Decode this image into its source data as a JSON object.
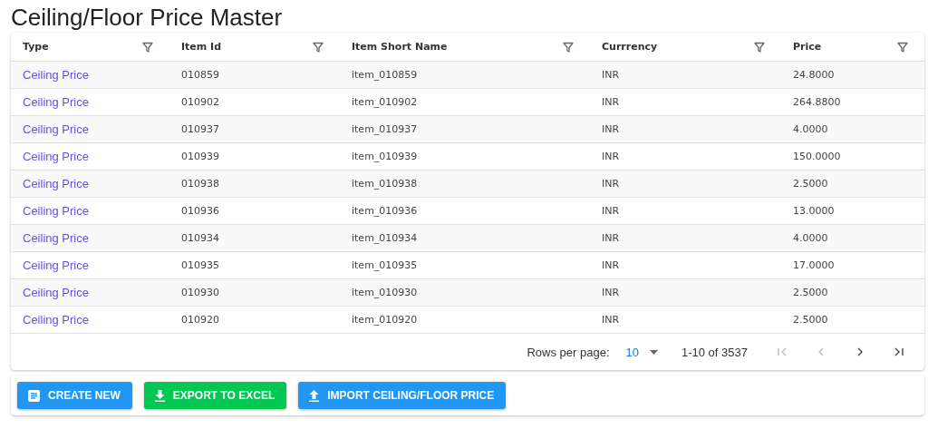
{
  "title": "Ceiling/Floor Price Master",
  "table": {
    "columns": [
      "Type",
      "Item Id",
      "Item Short Name",
      "Currrency",
      "Price"
    ],
    "rows": [
      [
        "Ceiling Price",
        "010859",
        "item_010859",
        "INR",
        "24.8000"
      ],
      [
        "Ceiling Price",
        "010902",
        "item_010902",
        "INR",
        "264.8800"
      ],
      [
        "Ceiling Price",
        "010937",
        "item_010937",
        "INR",
        "4.0000"
      ],
      [
        "Ceiling Price",
        "010939",
        "item_010939",
        "INR",
        "150.0000"
      ],
      [
        "Ceiling Price",
        "010938",
        "item_010938",
        "INR",
        "2.5000"
      ],
      [
        "Ceiling Price",
        "010936",
        "item_010936",
        "INR",
        "13.0000"
      ],
      [
        "Ceiling Price",
        "010934",
        "item_010934",
        "INR",
        "4.0000"
      ],
      [
        "Ceiling Price",
        "010935",
        "item_010935",
        "INR",
        "17.0000"
      ],
      [
        "Ceiling Price",
        "010930",
        "item_010930",
        "INR",
        "2.5000"
      ],
      [
        "Ceiling Price",
        "010920",
        "item_010920",
        "INR",
        "2.5000"
      ]
    ]
  },
  "pagination": {
    "rows_per_page_label": "Rows per page:",
    "rows_per_page": "10",
    "range": "1-10 of 3537"
  },
  "buttons": [
    {
      "kind": "create",
      "label": "CREATE NEW"
    },
    {
      "kind": "export",
      "label": "EXPORT TO EXCEL"
    },
    {
      "kind": "import",
      "label": "IMPORT CEILING/FLOOR PRICE"
    }
  ]
}
